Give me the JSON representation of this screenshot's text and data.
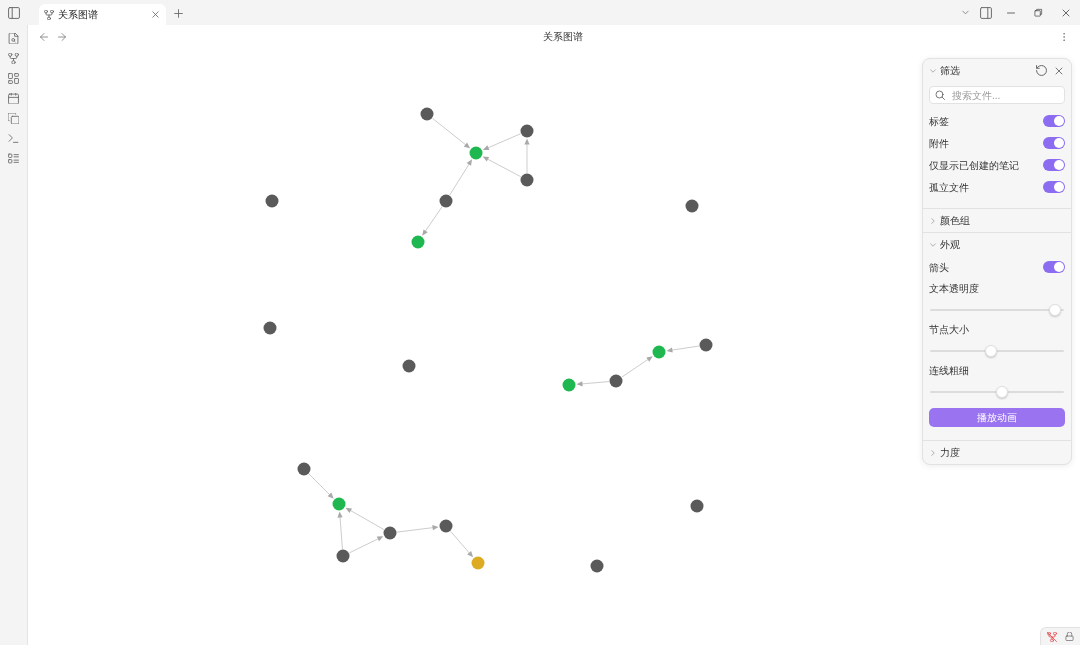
{
  "tabs": [
    {
      "title": "关系图谱",
      "selected": true
    }
  ],
  "view": {
    "title": "关系图谱"
  },
  "graph": {
    "nodes": [
      {
        "color": "#5a5a5a"
      },
      {
        "color": "#5a5a5a"
      },
      {
        "color": "#1fb850"
      },
      {
        "color": "#5a5a5a"
      },
      {
        "color": "#5a5a5a"
      },
      {
        "color": "#5a5a5a"
      },
      {
        "color": "#5a5a5a"
      },
      {
        "color": "#1fb850"
      },
      {
        "color": "#5a5a5a"
      },
      {
        "color": "#5a5a5a"
      },
      {
        "color": "#1fb850"
      },
      {
        "color": "#5a5a5a"
      },
      {
        "color": "#5a5a5a"
      },
      {
        "color": "#1fb850"
      },
      {
        "color": "#5a5a5a"
      },
      {
        "color": "#1fb850"
      },
      {
        "color": "#5a5a5a"
      },
      {
        "color": "#5a5a5a"
      },
      {
        "color": "#5a5a5a"
      },
      {
        "color": "#5a5a5a"
      },
      {
        "color": "#dcab22"
      },
      {
        "color": "#5a5a5a"
      }
    ]
  },
  "panel": {
    "sections": [
      {
        "title": "筛选",
        "expanded": true,
        "controls": [
          {
            "kind": "search",
            "placeholder": "搜索文件..."
          },
          {
            "kind": "toggle",
            "label": "标签",
            "on": true
          },
          {
            "kind": "toggle",
            "label": "附件",
            "on": true
          },
          {
            "kind": "toggle",
            "label": "仅显示已创建的笔记",
            "on": true
          },
          {
            "kind": "toggle",
            "label": "孤立文件",
            "on": true
          }
        ]
      },
      {
        "title": "颜色组",
        "expanded": false
      },
      {
        "title": "外观",
        "expanded": true,
        "controls": [
          {
            "kind": "toggle",
            "label": "箭头",
            "on": true
          },
          {
            "kind": "slider",
            "label": "文本透明度",
            "level": 1
          },
          {
            "kind": "slider",
            "label": "节点大小",
            "level": 0.45
          },
          {
            "kind": "slider",
            "label": "连线粗细",
            "level": 0.54
          },
          {
            "kind": "button",
            "label": "播放动画"
          }
        ]
      },
      {
        "title": "力度",
        "expanded": false
      }
    ]
  }
}
